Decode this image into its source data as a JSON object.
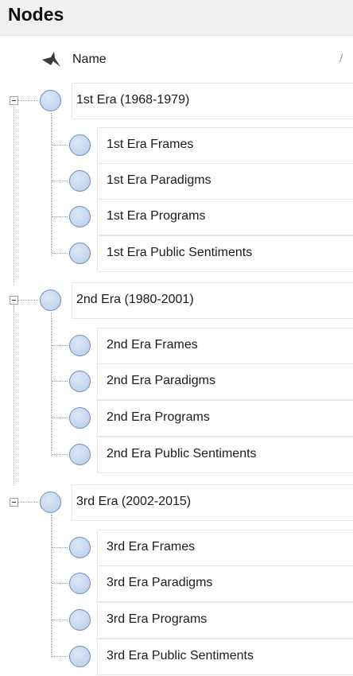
{
  "panel": {
    "title": "Nodes"
  },
  "columns": {
    "name": "Name",
    "sort_indicator": "/"
  },
  "eras": [
    {
      "label": "1st Era (1968-1979)",
      "children": [
        "1st Era Frames",
        "1st Era Paradigms",
        "1st Era Programs",
        "1st Era Public Sentiments"
      ]
    },
    {
      "label": "2nd Era (1980-2001)",
      "children": [
        "2nd Era Frames",
        "2nd Era Paradigms",
        "2nd Era Programs",
        "2nd Era Public Sentiments"
      ]
    },
    {
      "label": "3rd Era (2002-2015)",
      "children": [
        "3rd Era Frames",
        "3rd Era Paradigms",
        "3rd Era Programs",
        "3rd Era Public Sentiments"
      ]
    }
  ]
}
